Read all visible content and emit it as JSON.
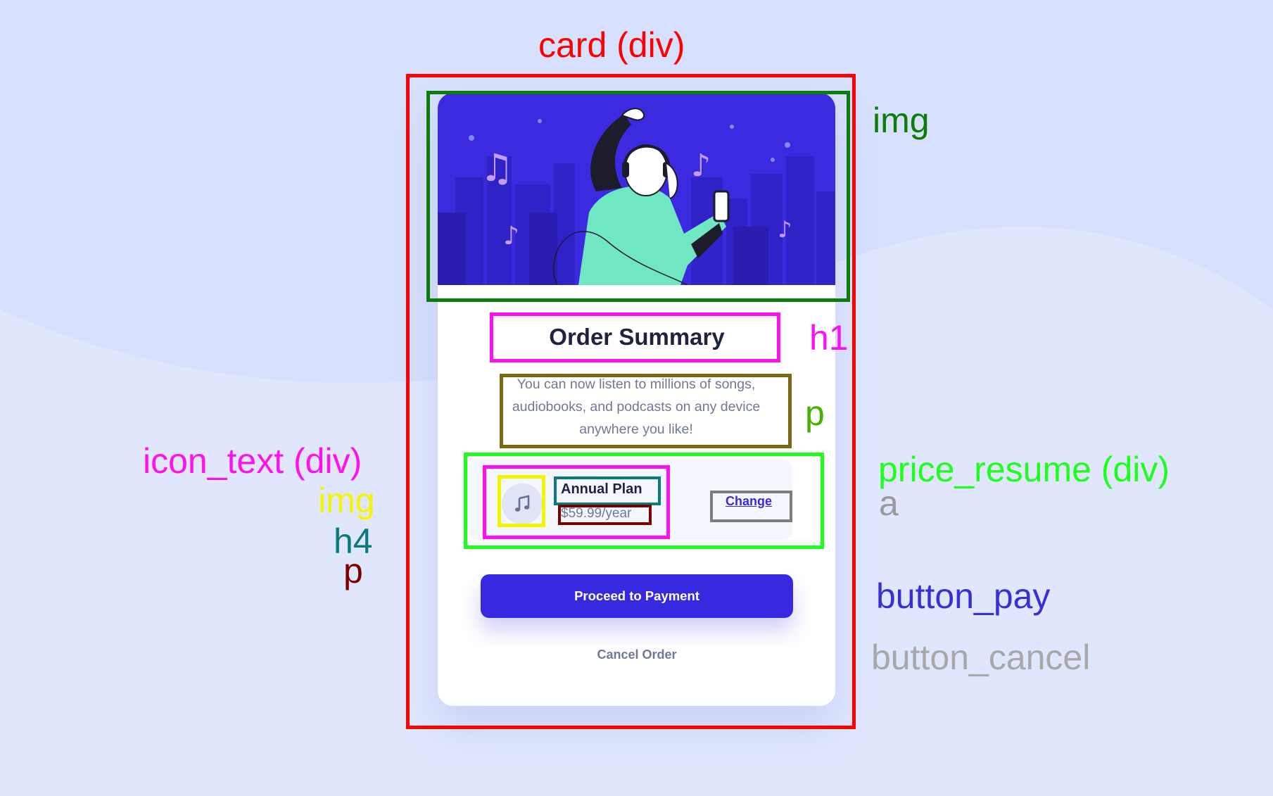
{
  "colors": {
    "background": "#d7e0fc",
    "card": "#ffffff",
    "accent": "#3829e0",
    "text_dark": "#1f2340",
    "text_muted": "#717896",
    "price_bg": "#f5f7ff"
  },
  "card": {
    "title": "Order Summary",
    "description": "You can now listen to millions of songs, audiobooks, and podcasts on any device anywhere you like!",
    "plan": {
      "icon": "music-note-icon",
      "name": "Annual Plan",
      "price": "$59.99/year",
      "change_label": "Change"
    },
    "pay_label": "Proceed to Payment",
    "cancel_label": "Cancel Order",
    "hero_icon": "person-dancing-headphones-illustration"
  },
  "annotations": {
    "card": "card (div)",
    "img": "img",
    "h1": "h1",
    "p": "p",
    "icon_text": "icon_text (div)",
    "icon_img": "img",
    "h4": "h4",
    "p2": "p",
    "price_resume": "price_resume (div)",
    "a": "a",
    "button_pay": "button_pay",
    "button_cancel": "button_cancel"
  },
  "annotation_colors": {
    "card": "#ff0000",
    "img": "#0a7d0a",
    "h1": "#ff10ee",
    "p": "#7d6914",
    "icon_text": "#ff10ee",
    "icon_img": "#f5f500",
    "h4": "#0a7a7a",
    "p2": "#7d0000",
    "price_resume": "#1dff1d",
    "a": "#7d7d7d",
    "button_pay": "#3a2fd6",
    "button_cancel": "#a8a8a8",
    "p_label": "#48b000",
    "a_label": "#9a9a9a"
  }
}
